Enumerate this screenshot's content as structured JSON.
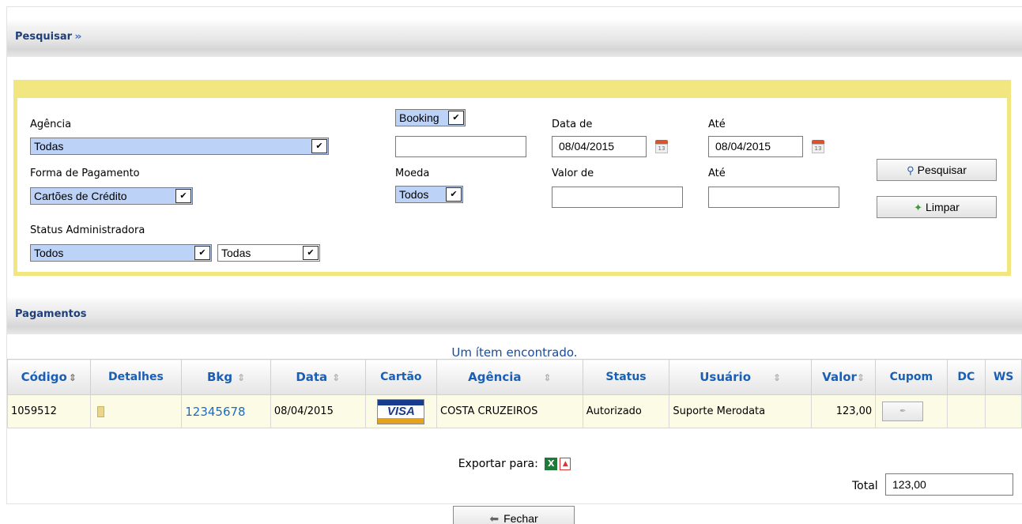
{
  "search": {
    "title": "Pesquisar",
    "labels": {
      "agencia": "Agência",
      "forma_pagamento": "Forma de Pagamento",
      "status_admin": "Status Administradora",
      "moeda": "Moeda",
      "data_de": "Data de",
      "ate_data": "Até",
      "valor_de": "Valor de",
      "ate_valor": "Até"
    },
    "values": {
      "agencia": "Todas",
      "forma_pagamento": "Cartões de Crédito",
      "status_admin_1": "Todos",
      "status_admin_2": "Todas",
      "booking_type": "Booking",
      "booking_value": "",
      "moeda": "Todos",
      "data_de": "08/04/2015",
      "ate_data": "08/04/2015",
      "valor_de": "",
      "ate_valor": ""
    },
    "buttons": {
      "pesquisar": "Pesquisar",
      "limpar": "Limpar"
    }
  },
  "payments": {
    "title": "Pagamentos",
    "found_text": "Um ítem encontrado.",
    "columns": [
      "Código",
      "Detalhes",
      "Bkg",
      "Data",
      "Cartão",
      "Agência",
      "Status",
      "Usuário",
      "Valor",
      "Cupom",
      "DC",
      "WS"
    ],
    "rows": [
      {
        "codigo": "1059512",
        "bkg": "12345678",
        "data": "08/04/2015",
        "cartao": "VISA",
        "agencia": "COSTA CRUZEIROS",
        "status": "Autorizado",
        "usuario": "Suporte Merodata",
        "valor": "123,00",
        "dc": "",
        "ws": ""
      }
    ],
    "export_label": "Exportar para:",
    "total_label": "Total",
    "total_value": "123,00"
  },
  "footer": {
    "close_label": "Fechar"
  },
  "icons": {
    "chevron": "double-chevron-down-icon",
    "calendar": "calendar-icon",
    "search": "magnifier-icon",
    "clear": "eraser-icon",
    "details": "document-icon",
    "excel": "excel-icon",
    "pdf": "pdf-icon",
    "back": "arrow-left-icon"
  }
}
